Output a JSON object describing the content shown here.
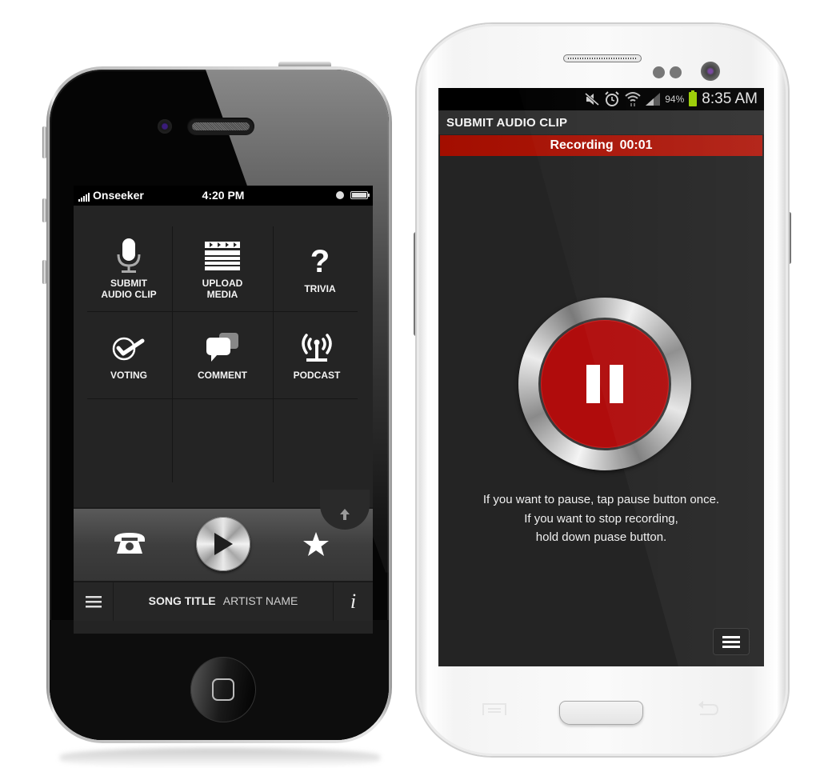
{
  "iphone": {
    "status": {
      "carrier": "Onseeker",
      "time": "4:20 PM",
      "signal_bars": 5,
      "battery_pct": 100
    },
    "grid": [
      {
        "label": "SUBMIT\nAUDIO CLIP",
        "icon": "microphone-icon"
      },
      {
        "label": "UPLOAD\nMEDIA",
        "icon": "clapperboard-icon"
      },
      {
        "label": "TRIVIA",
        "icon": "question-icon"
      },
      {
        "label": "VOTING",
        "icon": "check-circle-icon"
      },
      {
        "label": "COMMENT",
        "icon": "speech-bubbles-icon"
      },
      {
        "label": "PODCAST",
        "icon": "broadcast-antenna-icon"
      }
    ],
    "player": {
      "left_icon": "telephone-icon",
      "center_icon": "play-icon",
      "right_icon": "star-icon",
      "expand_icon": "arrow-up-icon"
    },
    "now_playing": {
      "song_title": "SONG TITLE",
      "artist_name": "ARTIST NAME",
      "menu_icon": "hamburger-icon",
      "info_label": "i"
    }
  },
  "galaxy": {
    "status": {
      "battery_pct": "94%",
      "time": "8:35 AM",
      "icons": [
        "mute-icon",
        "alarm-icon",
        "wifi-icon",
        "signal-icon",
        "battery-icon"
      ]
    },
    "title": "SUBMIT AUDIO CLIP",
    "recording": {
      "label": "Recording",
      "timer": "00:01"
    },
    "instructions": [
      "If you want to pause, tap pause button once.",
      "If you want to stop recording,",
      "hold down puase button."
    ],
    "colors": {
      "record_red": "#b00c0c",
      "battery_green": "#99cc00"
    }
  }
}
